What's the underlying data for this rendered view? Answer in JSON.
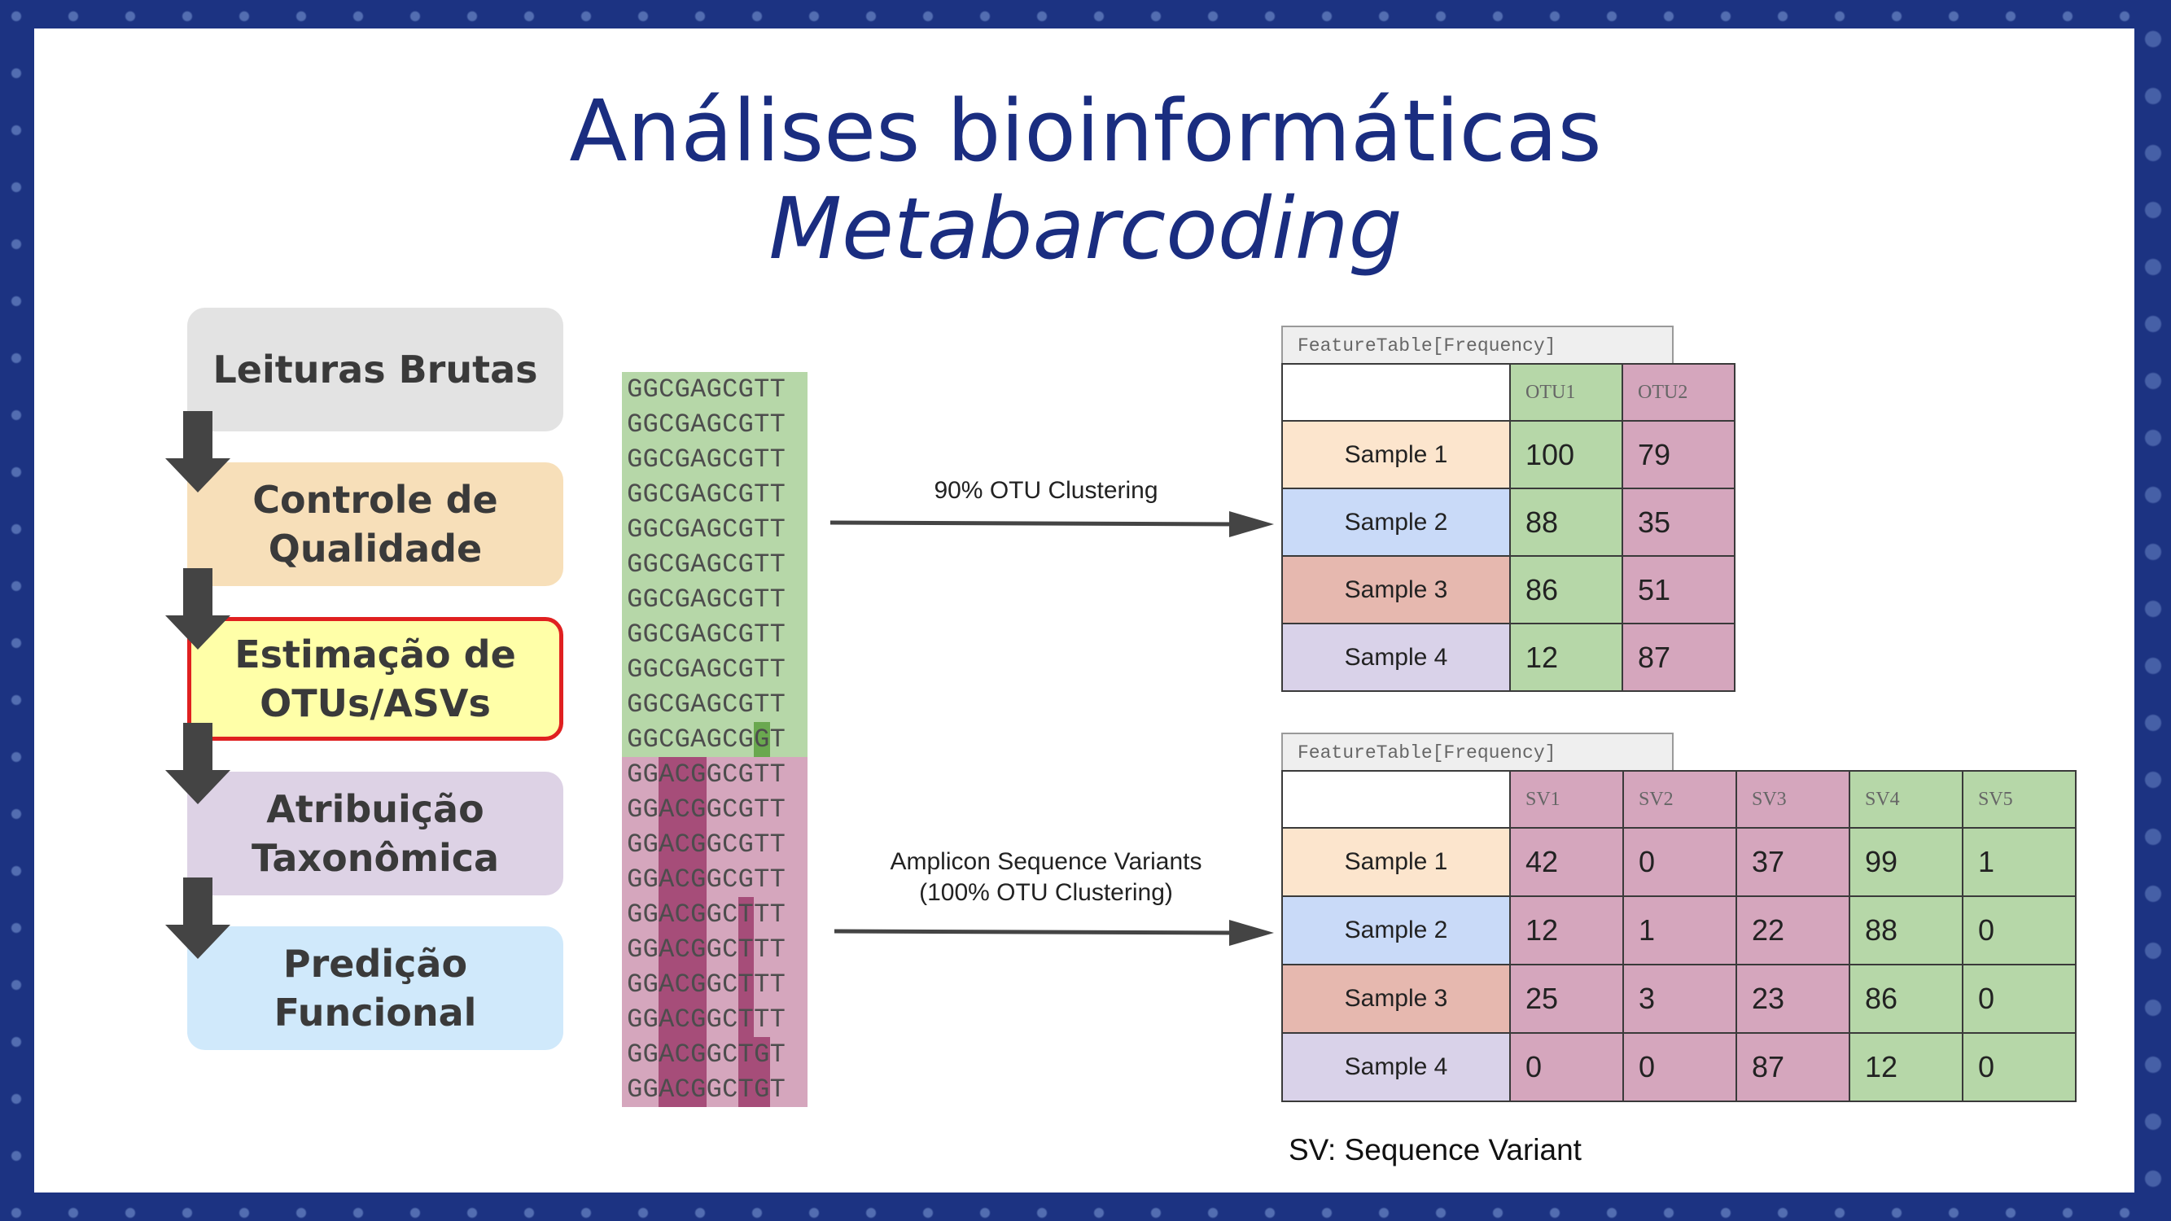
{
  "title": {
    "line1": "Análises bioinformáticas",
    "line2": "Metabarcoding"
  },
  "steps": [
    {
      "label": "Leituras Brutas",
      "color": "#e3e3e3"
    },
    {
      "label": "Controle de\nQualidade",
      "color": "#f7dfb9"
    },
    {
      "label": "Estimação de\nOTUs/ASVs",
      "color": "#ffffa8",
      "highlight": "#e02020"
    },
    {
      "label": "Atribuição\nTaxonômica",
      "color": "#ddd2e5"
    },
    {
      "label": "Predição\nFuncional",
      "color": "#d0e9fb"
    }
  ],
  "sequences": [
    "GGCGAGCGTT",
    "GGCGAGCGTT",
    "GGCGAGCGTT",
    "GGCGAGCGTT",
    "GGCGAGCGTT",
    "GGCGAGCGTT",
    "GGCGAGCGTT",
    "GGCGAGCGTT",
    "GGCGAGCGTT",
    "GGCGAGCGTT",
    "GGCGAGCGGT",
    "GGACGGCGTT",
    "GGACGGCGTT",
    "GGACGGCGTT",
    "GGACGGCGTT",
    "GGACGGCTTT",
    "GGACGGCTTT",
    "GGACGGCTTT",
    "GGACGGCTTT",
    "GGACGGCTGT",
    "GGACGGCTGT"
  ],
  "annotations": {
    "otu": "90% OTU Clustering",
    "asv_line1": "Amplicon Sequence Variants",
    "asv_line2": "(100% OTU Clustering)"
  },
  "otu_table": {
    "label": "FeatureTable[Frequency]",
    "columns": [
      "OTU1",
      "OTU2"
    ],
    "rows": [
      {
        "sample": "Sample 1",
        "values": [
          "100",
          "79"
        ]
      },
      {
        "sample": "Sample 2",
        "values": [
          "88",
          "35"
        ]
      },
      {
        "sample": "Sample 3",
        "values": [
          "86",
          "51"
        ]
      },
      {
        "sample": "Sample 4",
        "values": [
          "12",
          "87"
        ]
      }
    ]
  },
  "sv_table": {
    "label": "FeatureTable[Frequency]",
    "columns": [
      "SV1",
      "SV2",
      "SV3",
      "SV4",
      "SV5"
    ],
    "rows": [
      {
        "sample": "Sample 1",
        "values": [
          "42",
          "0",
          "37",
          "99",
          "1"
        ]
      },
      {
        "sample": "Sample 2",
        "values": [
          "12",
          "1",
          "22",
          "88",
          "0"
        ]
      },
      {
        "sample": "Sample 3",
        "values": [
          "25",
          "3",
          "23",
          "86",
          "0"
        ]
      },
      {
        "sample": "Sample 4",
        "values": [
          "0",
          "0",
          "87",
          "12",
          "0"
        ]
      }
    ]
  },
  "footnote": "SV: Sequence Variant",
  "colors": {
    "green": "#b6d7a8",
    "green_dark": "#6aa84f",
    "pink": "#d5a6bd",
    "pink_dark": "#a64d79",
    "sample1": "#fce5cd",
    "sample2": "#c9daf8",
    "sample3": "#e6b8af",
    "sample4": "#d9d2e9",
    "title": "#1a2d80",
    "arrow": "#444444"
  }
}
